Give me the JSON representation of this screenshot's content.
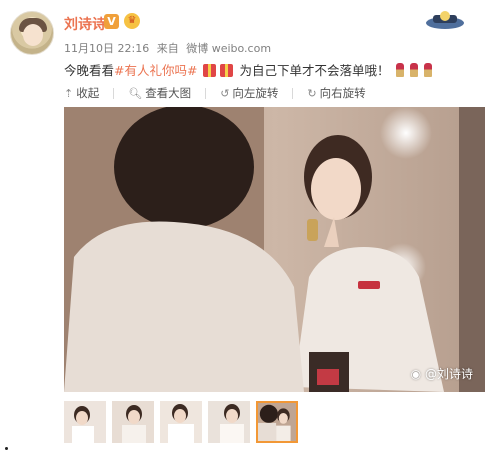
{
  "user": {
    "name": "刘诗诗"
  },
  "meta": {
    "date": "11月10日 22:16",
    "source_prefix": "来自",
    "source": "微博 weibo.com"
  },
  "post": {
    "text_before": "今晚看看",
    "topic": "#有人礼你吗#",
    "text_after": "为自己下单才不会落单哦！"
  },
  "toolbar": {
    "collect": "收起",
    "view_large": "查看大图",
    "rotate_left": "向左旋转",
    "rotate_right": "向右旋转"
  },
  "photo": {
    "watermark": "@刘诗诗"
  },
  "colors": {
    "accent": "#eb7350",
    "thumb_active": "#f29836"
  },
  "icons": [
    "verified-icon",
    "vip-icon",
    "gift-icon",
    "lipstick-icon",
    "collapse-icon",
    "zoom-icon",
    "rotate-left-icon",
    "rotate-right-icon",
    "weibo-icon"
  ],
  "thumbnails_count": 5,
  "active_thumbnail_index": 4
}
